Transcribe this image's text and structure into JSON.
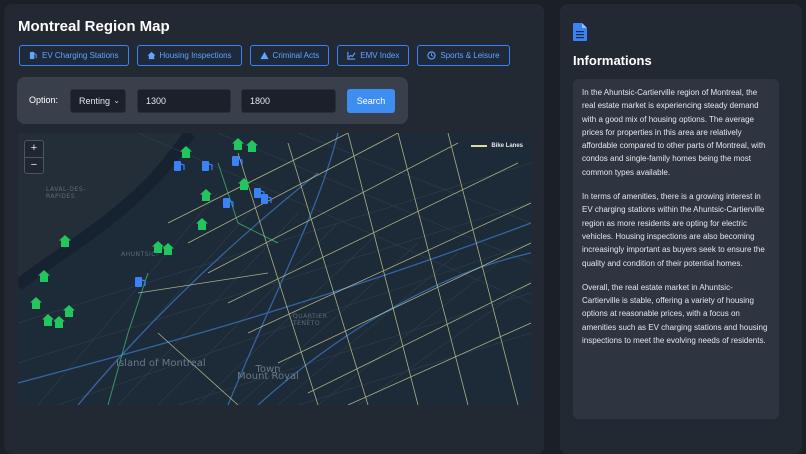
{
  "page": {
    "title": "Montreal Region Map"
  },
  "layers": [
    {
      "label": "EV Charging Stations",
      "icon": "charging-station-icon"
    },
    {
      "label": "Housing Inspections",
      "icon": "house-icon"
    },
    {
      "label": "Criminal Acts",
      "icon": "warning-icon"
    },
    {
      "label": "EMV Index",
      "icon": "chart-icon"
    },
    {
      "label": "Sports & Leisure",
      "icon": "clock-icon"
    }
  ],
  "filter": {
    "label": "Option:",
    "option_value": "Renting",
    "min_value": "1300",
    "max_value": "1800",
    "search_label": "Search"
  },
  "map": {
    "zoom_in": "+",
    "zoom_out": "−",
    "legend_label": "Bike Lanes",
    "labels": {
      "laval": "LAVAL-DES-\nRAPIDES",
      "ahuntsic": "AHUNTSIC-",
      "island": "Island of Montreal",
      "mount": "Town\nMount Royal",
      "tenet": "QUARTIER\nTÉNÉTO"
    },
    "colors": {
      "house_marker": "#22c55e",
      "ev_marker": "#3b82f6",
      "bike_lane": "#d8dc9c"
    }
  },
  "info": {
    "title": "Informations",
    "paragraphs": [
      "In the Ahuntsic-Cartierville region of Montreal, the real estate market is experiencing steady demand with a good mix of housing options. The average prices for properties in this area are relatively affordable compared to other parts of Montreal, with condos and single-family homes being the most common types available.",
      "In terms of amenities, there is a growing interest in EV charging stations within the Ahuntsic-Cartierville region as more residents are opting for electric vehicles. Housing inspections are also becoming increasingly important as buyers seek to ensure the quality and condition of their potential homes.",
      "Overall, the real estate market in Ahuntsic-Cartierville is stable, offering a variety of housing options at reasonable prices, with a focus on amenities such as EV charging stations and housing inspections to meet the evolving needs of residents."
    ]
  }
}
